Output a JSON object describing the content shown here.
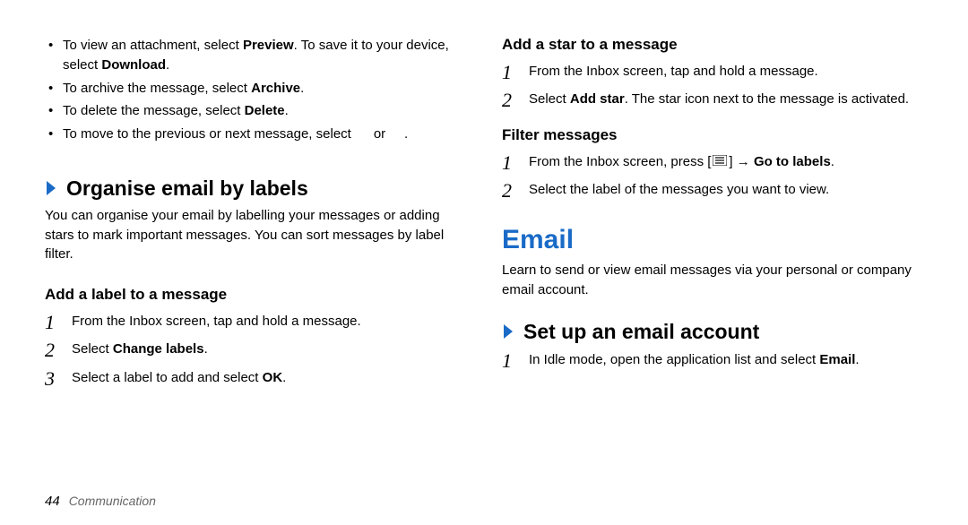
{
  "left": {
    "bullets": {
      "b1_pre": "To view an attachment, select ",
      "b1_bold1": "Preview",
      "b1_mid": ". To save it to your device, select ",
      "b1_bold2": "Download",
      "b1_post": ".",
      "b2_pre": "To archive the message, select ",
      "b2_bold": "Archive",
      "b2_post": ".",
      "b3_pre": "To delete the message, select ",
      "b3_bold": "Delete",
      "b3_post": ".",
      "b4_pre": "To move to the previous or next message, select ",
      "b4_mid": " or ",
      "b4_post": "."
    },
    "organise": {
      "heading": "Organise email by labels",
      "para": "You can organise your email by labelling your messages or adding stars to mark important messages. You can sort messages by label filter."
    },
    "add_label": {
      "heading": "Add a label to a message",
      "step1": "From the Inbox screen, tap and hold a message.",
      "step2_pre": "Select ",
      "step2_bold": "Change labels",
      "step2_post": ".",
      "step3_pre": "Select a label to add and select ",
      "step3_bold": "OK",
      "step3_post": "."
    }
  },
  "right": {
    "add_star": {
      "heading": "Add a star to a message",
      "step1": "From the Inbox screen, tap and hold a message.",
      "step2_pre": "Select ",
      "step2_bold": "Add star",
      "step2_post": ". The star icon next to the message is activated."
    },
    "filter": {
      "heading": "Filter messages",
      "step1_pre": "From the Inbox screen, press [",
      "step1_mid": "] → ",
      "step1_bold": "Go to labels",
      "step1_post": ".",
      "step2": "Select the label of the messages you want to view."
    },
    "email": {
      "heading": "Email",
      "para": "Learn to send or view email messages via your personal or company email account."
    },
    "setup": {
      "heading": "Set up an email account",
      "step1_pre": "In Idle mode, open the application list and select ",
      "step1_bold": "Email",
      "step1_post": "."
    }
  },
  "footer": {
    "page": "44",
    "section": "Communication"
  },
  "colors": {
    "accent": "#1a6bc7"
  }
}
